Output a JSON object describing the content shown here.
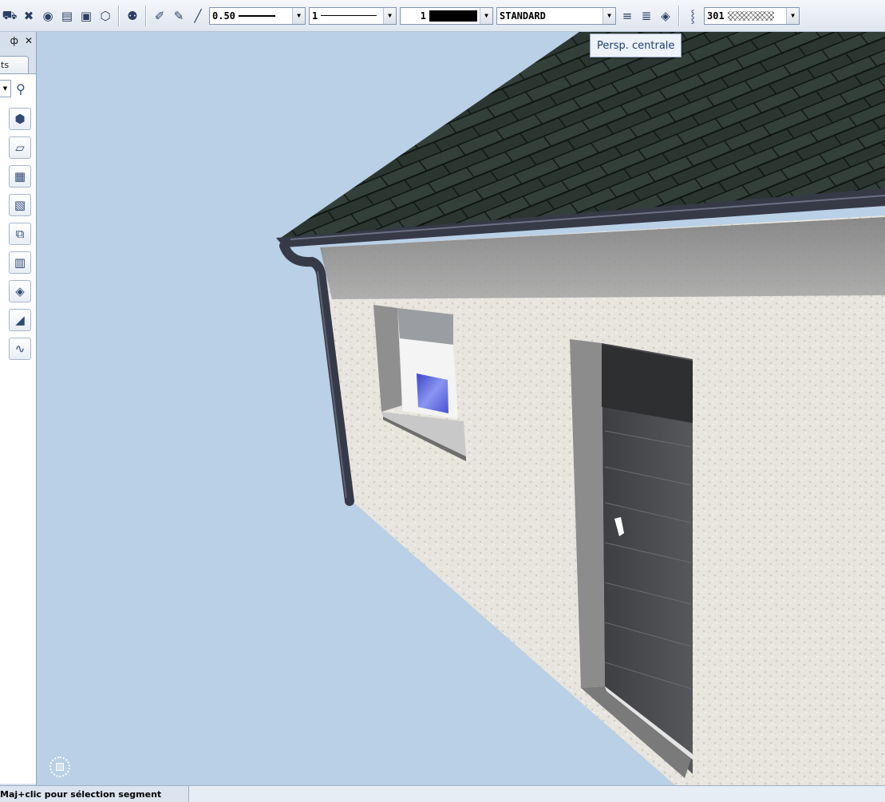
{
  "toolbar": {
    "icons": [
      "measure-icon",
      "tools-icon",
      "eye-icon",
      "folder-open-icon",
      "image-export-icon",
      "box-3d-icon",
      "help-zoom-icon",
      "paint-brush-icon",
      "pencil-icon",
      "eyedropper-icon",
      "layers-up-icon",
      "layers-down-icon",
      "layers-icon",
      "hatch-chain-icon"
    ],
    "line_width": "0.50",
    "line_style": "1",
    "color": "1",
    "layer": "STANDARD",
    "hatch": "301"
  },
  "tooltip": "Persp. centrale",
  "left_panel": {
    "tab_label": "ts",
    "pin_glyph": "ф",
    "close_glyph": "✕",
    "buttons": [
      "cube-icon",
      "floor-icon",
      "table-icon",
      "hatch-area-icon",
      "frame-3d-icon",
      "grid-icon",
      "tag-icon",
      "stamp-icon",
      "landscape-icon"
    ]
  },
  "status": {
    "message": "Maj+clic pour sélection segment"
  },
  "colors": {
    "sky": "#b9d0e6",
    "roof": "#2a3530",
    "wall": "#e9e6df",
    "door": "#4a4b4e",
    "gutter": "#363a47"
  }
}
